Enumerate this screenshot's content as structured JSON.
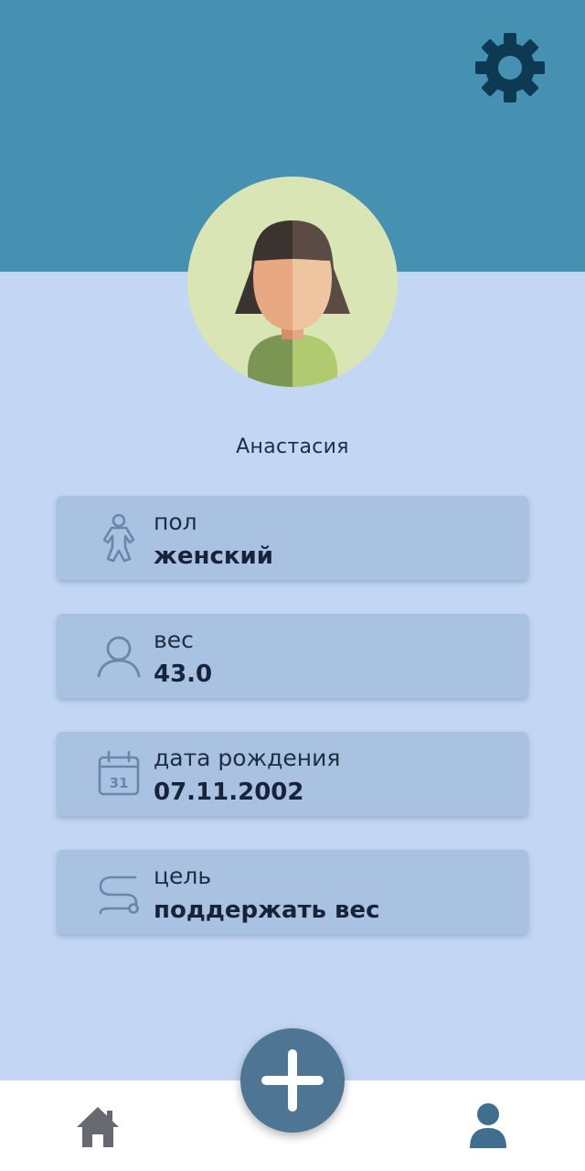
{
  "header": {
    "settings_icon": "gear-icon",
    "colors": {
      "header_bg": "#4690b2",
      "gear": "#0d3a52"
    }
  },
  "profile": {
    "name": "Анастасия",
    "avatar_icon": "woman-avatar"
  },
  "cards": [
    {
      "icon": "baby-body-icon",
      "label": "пол",
      "value": "женский"
    },
    {
      "icon": "person-icon",
      "label": "вес",
      "value": "43.0"
    },
    {
      "icon": "calendar-icon",
      "label": "дата рождения",
      "value": "07.11.2002",
      "calendar_day": "31"
    },
    {
      "icon": "route-icon",
      "label": "цель",
      "value": "поддержать вес"
    }
  ],
  "bottom_nav": {
    "items": [
      {
        "name": "home",
        "icon": "home-icon"
      },
      {
        "name": "profile",
        "icon": "person-icon"
      }
    ],
    "fab_icon": "plus-icon"
  },
  "colors": {
    "background": "#c3d7f4",
    "card": "#a9c2e2",
    "icon": "#6a85aa",
    "fab": "#4e7593"
  }
}
